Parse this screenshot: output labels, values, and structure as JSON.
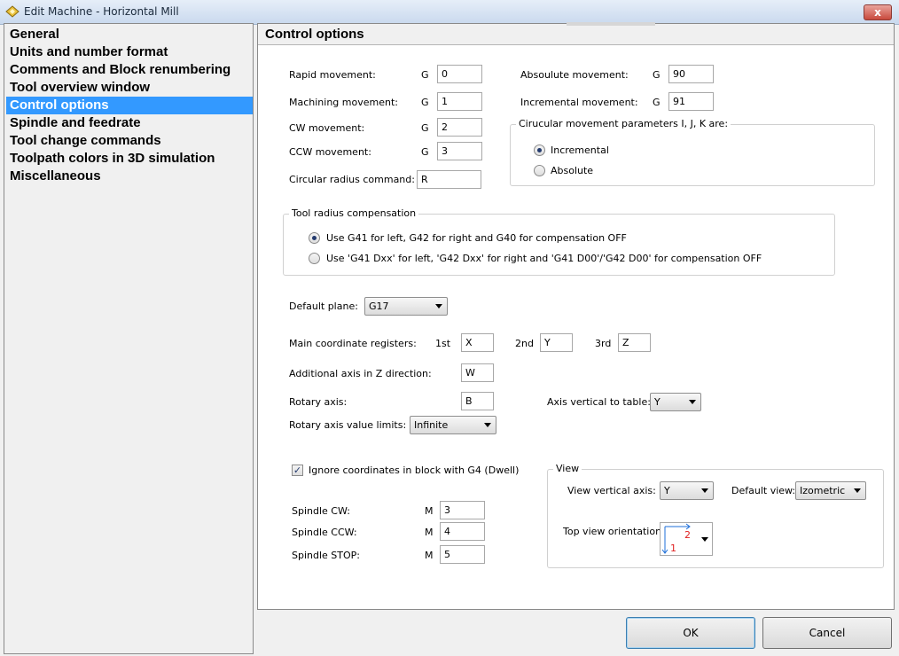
{
  "window": {
    "title": "Edit Machine - Horizontal Mill",
    "close_glyph": "x"
  },
  "nav": {
    "items": [
      "General",
      "Units and number format",
      "Comments and Block renumbering",
      "Tool overview window",
      "Control options",
      "Spindle and feedrate",
      "Tool change commands",
      "Toolpath colors in 3D simulation",
      "Miscellaneous"
    ],
    "active_index": 4
  },
  "panel": {
    "title": "Control options"
  },
  "movement": {
    "rapid": {
      "label": "Rapid movement:",
      "prefix": "G",
      "value": "0"
    },
    "machining": {
      "label": "Machining movement:",
      "prefix": "G",
      "value": "1"
    },
    "cw": {
      "label": "CW movement:",
      "prefix": "G",
      "value": "2"
    },
    "ccw": {
      "label": "CCW movement:",
      "prefix": "G",
      "value": "3"
    },
    "radius": {
      "label": "Circular radius command:",
      "value": "R"
    },
    "absolute": {
      "label": "Absoulute movement:",
      "prefix": "G",
      "value": "90"
    },
    "incremental": {
      "label": "Incremental movement:",
      "prefix": "G",
      "value": "91"
    }
  },
  "circular_params": {
    "title": "Cirucular movement parameters I, J, K are:",
    "options": [
      "Incremental",
      "Absolute"
    ],
    "selected": "Incremental"
  },
  "tool_radius": {
    "title": "Tool radius compensation",
    "options": [
      "Use G41 for left, G42 for right and G40 for compensation OFF",
      "Use 'G41 Dxx' for left, 'G42 Dxx' for right and 'G41 D00'/'G42 D00' for compensation OFF"
    ],
    "selected_index": 0
  },
  "default_plane": {
    "label": "Default plane:",
    "value": "G17"
  },
  "coordinates": {
    "label": "Main coordinate registers:",
    "first_label": "1st",
    "first": "X",
    "second_label": "2nd",
    "second": "Y",
    "third_label": "3rd",
    "third": "Z"
  },
  "additional_axis": {
    "label": "Additional axis in Z direction:",
    "value": "W"
  },
  "rotary_axis": {
    "label": "Rotary axis:",
    "value": "B"
  },
  "axis_vertical": {
    "label": "Axis vertical to table:",
    "value": "Y"
  },
  "rotary_limits": {
    "label": "Rotary axis value limits:",
    "value": "Infinite"
  },
  "ignore_dwell": {
    "label": "Ignore coordinates in block with G4 (Dwell)",
    "checked": true
  },
  "spindle": {
    "cw": {
      "label": "Spindle CW:",
      "prefix": "M",
      "value": "3"
    },
    "ccw": {
      "label": "Spindle CCW:",
      "prefix": "M",
      "value": "4"
    },
    "stop": {
      "label": "Spindle STOP:",
      "prefix": "M",
      "value": "5"
    }
  },
  "view": {
    "title": "View",
    "vertical_axis_label": "View vertical axis:",
    "vertical_axis": "Y",
    "default_view_label": "Default view:",
    "default_view": "Izometric",
    "top_orientation_label": "Top view orientation:",
    "orientation_marks": {
      "x": "2",
      "y": "1"
    },
    "colors": {
      "axis": "#1e6fd9",
      "mark": "#e02020"
    }
  },
  "buttons": {
    "ok": "OK",
    "cancel": "Cancel"
  },
  "colors": {
    "selection": "#3399ff",
    "close": "#c8493c"
  }
}
